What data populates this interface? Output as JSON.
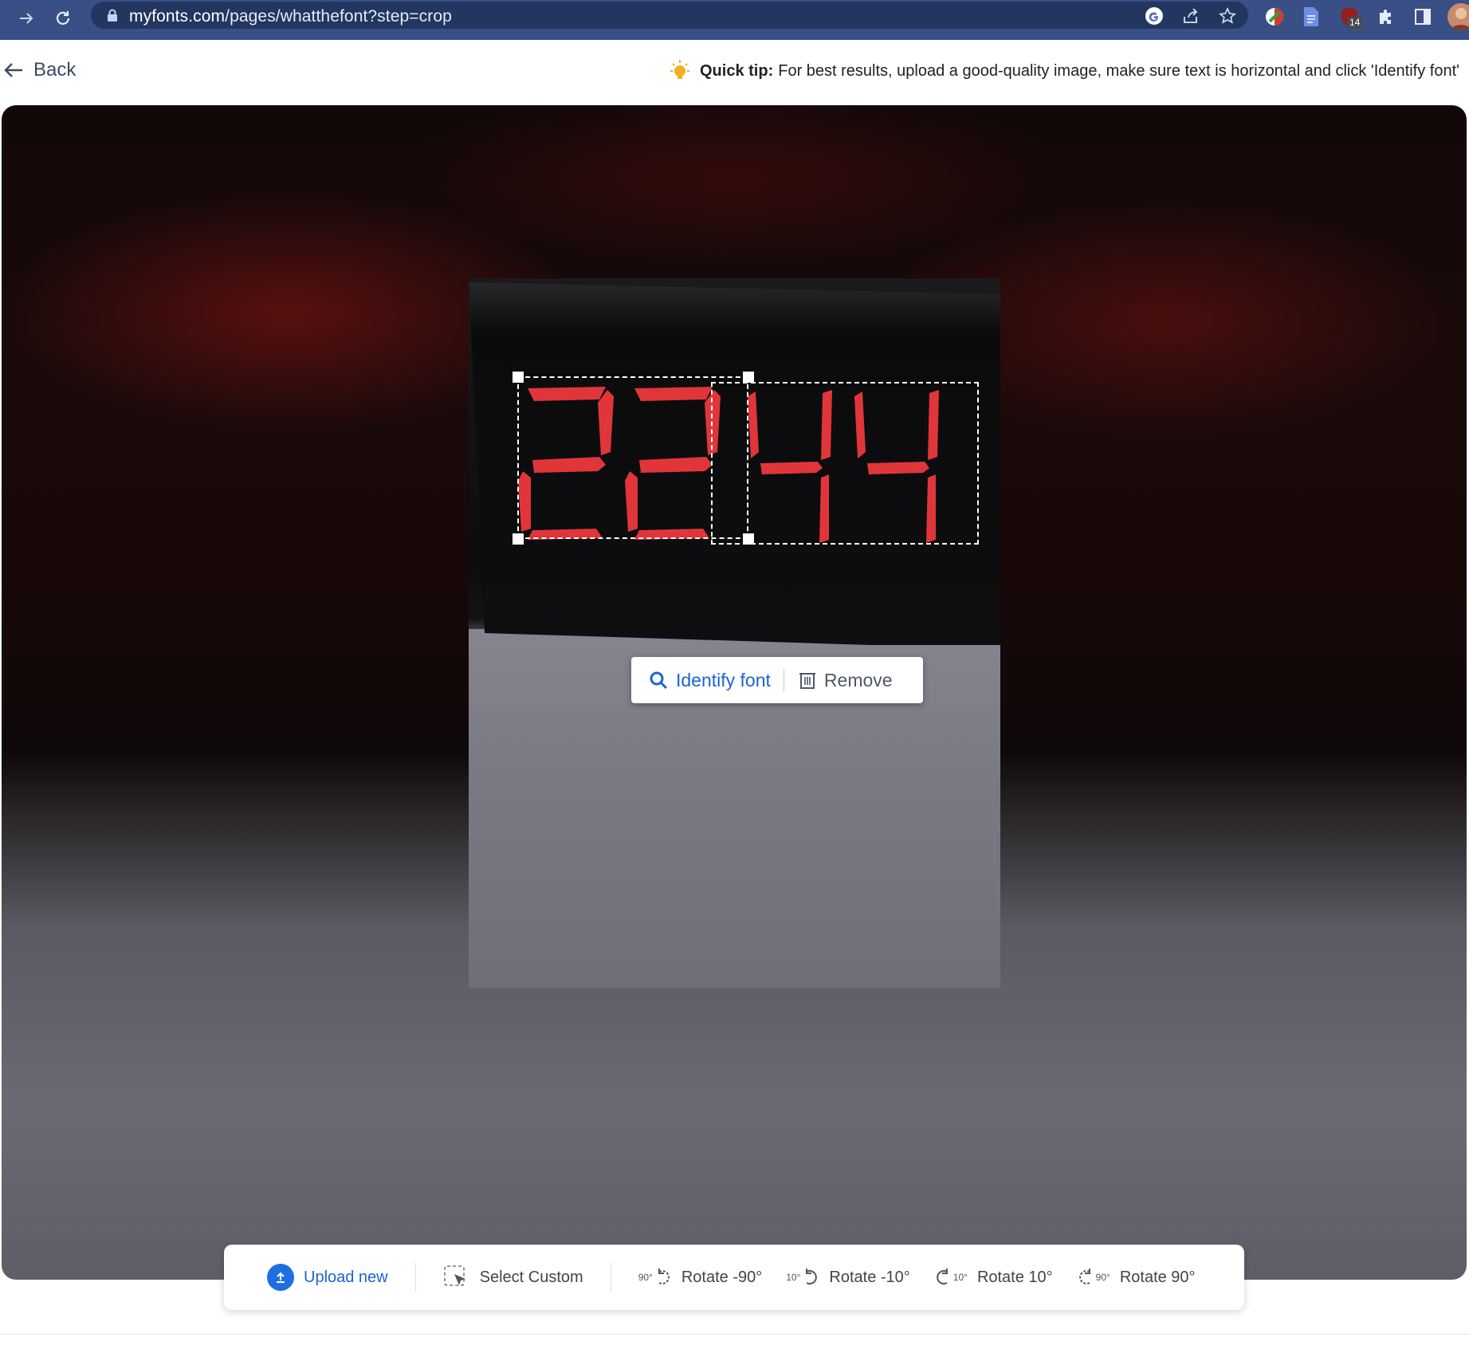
{
  "browser": {
    "url_host": "myfonts.com",
    "url_path": "/pages/whatthefont?step=crop",
    "extension_badge": "14"
  },
  "header": {
    "back_label": "Back",
    "quick_tip_label": "Quick tip:",
    "quick_tip_text": "For best results, upload a good-quality image, make sure text is horizontal and click 'Identify font'"
  },
  "crop_actions": {
    "identify_label": "Identify font",
    "remove_label": "Remove"
  },
  "toolbar": {
    "upload_label": "Upload new",
    "select_custom_label": "Select Custom",
    "rotate_ccw90_label": "Rotate -90°",
    "rotate_ccw10_label": "Rotate -10°",
    "rotate_cw10_label": "Rotate 10°",
    "rotate_cw90_label": "Rotate 90°",
    "rotate_ccw90_icon_text": "90°",
    "rotate_ccw10_icon_text": "10°",
    "rotate_cw10_icon_text": "10°",
    "rotate_cw90_icon_text": "90°"
  },
  "colors": {
    "accent": "#1a64d6",
    "browser_bar": "#3a4f86",
    "digit_red": "#e0363a",
    "tip_bulb": "#f2b01e"
  },
  "icons": {
    "back": "arrow-left-icon",
    "tip": "lightbulb-icon",
    "identify": "search-icon",
    "remove": "trash-icon",
    "upload": "upload-icon",
    "select": "select-cursor-icon",
    "rotate_left": "rotate-left-icon",
    "rotate_right": "rotate-right-icon"
  }
}
